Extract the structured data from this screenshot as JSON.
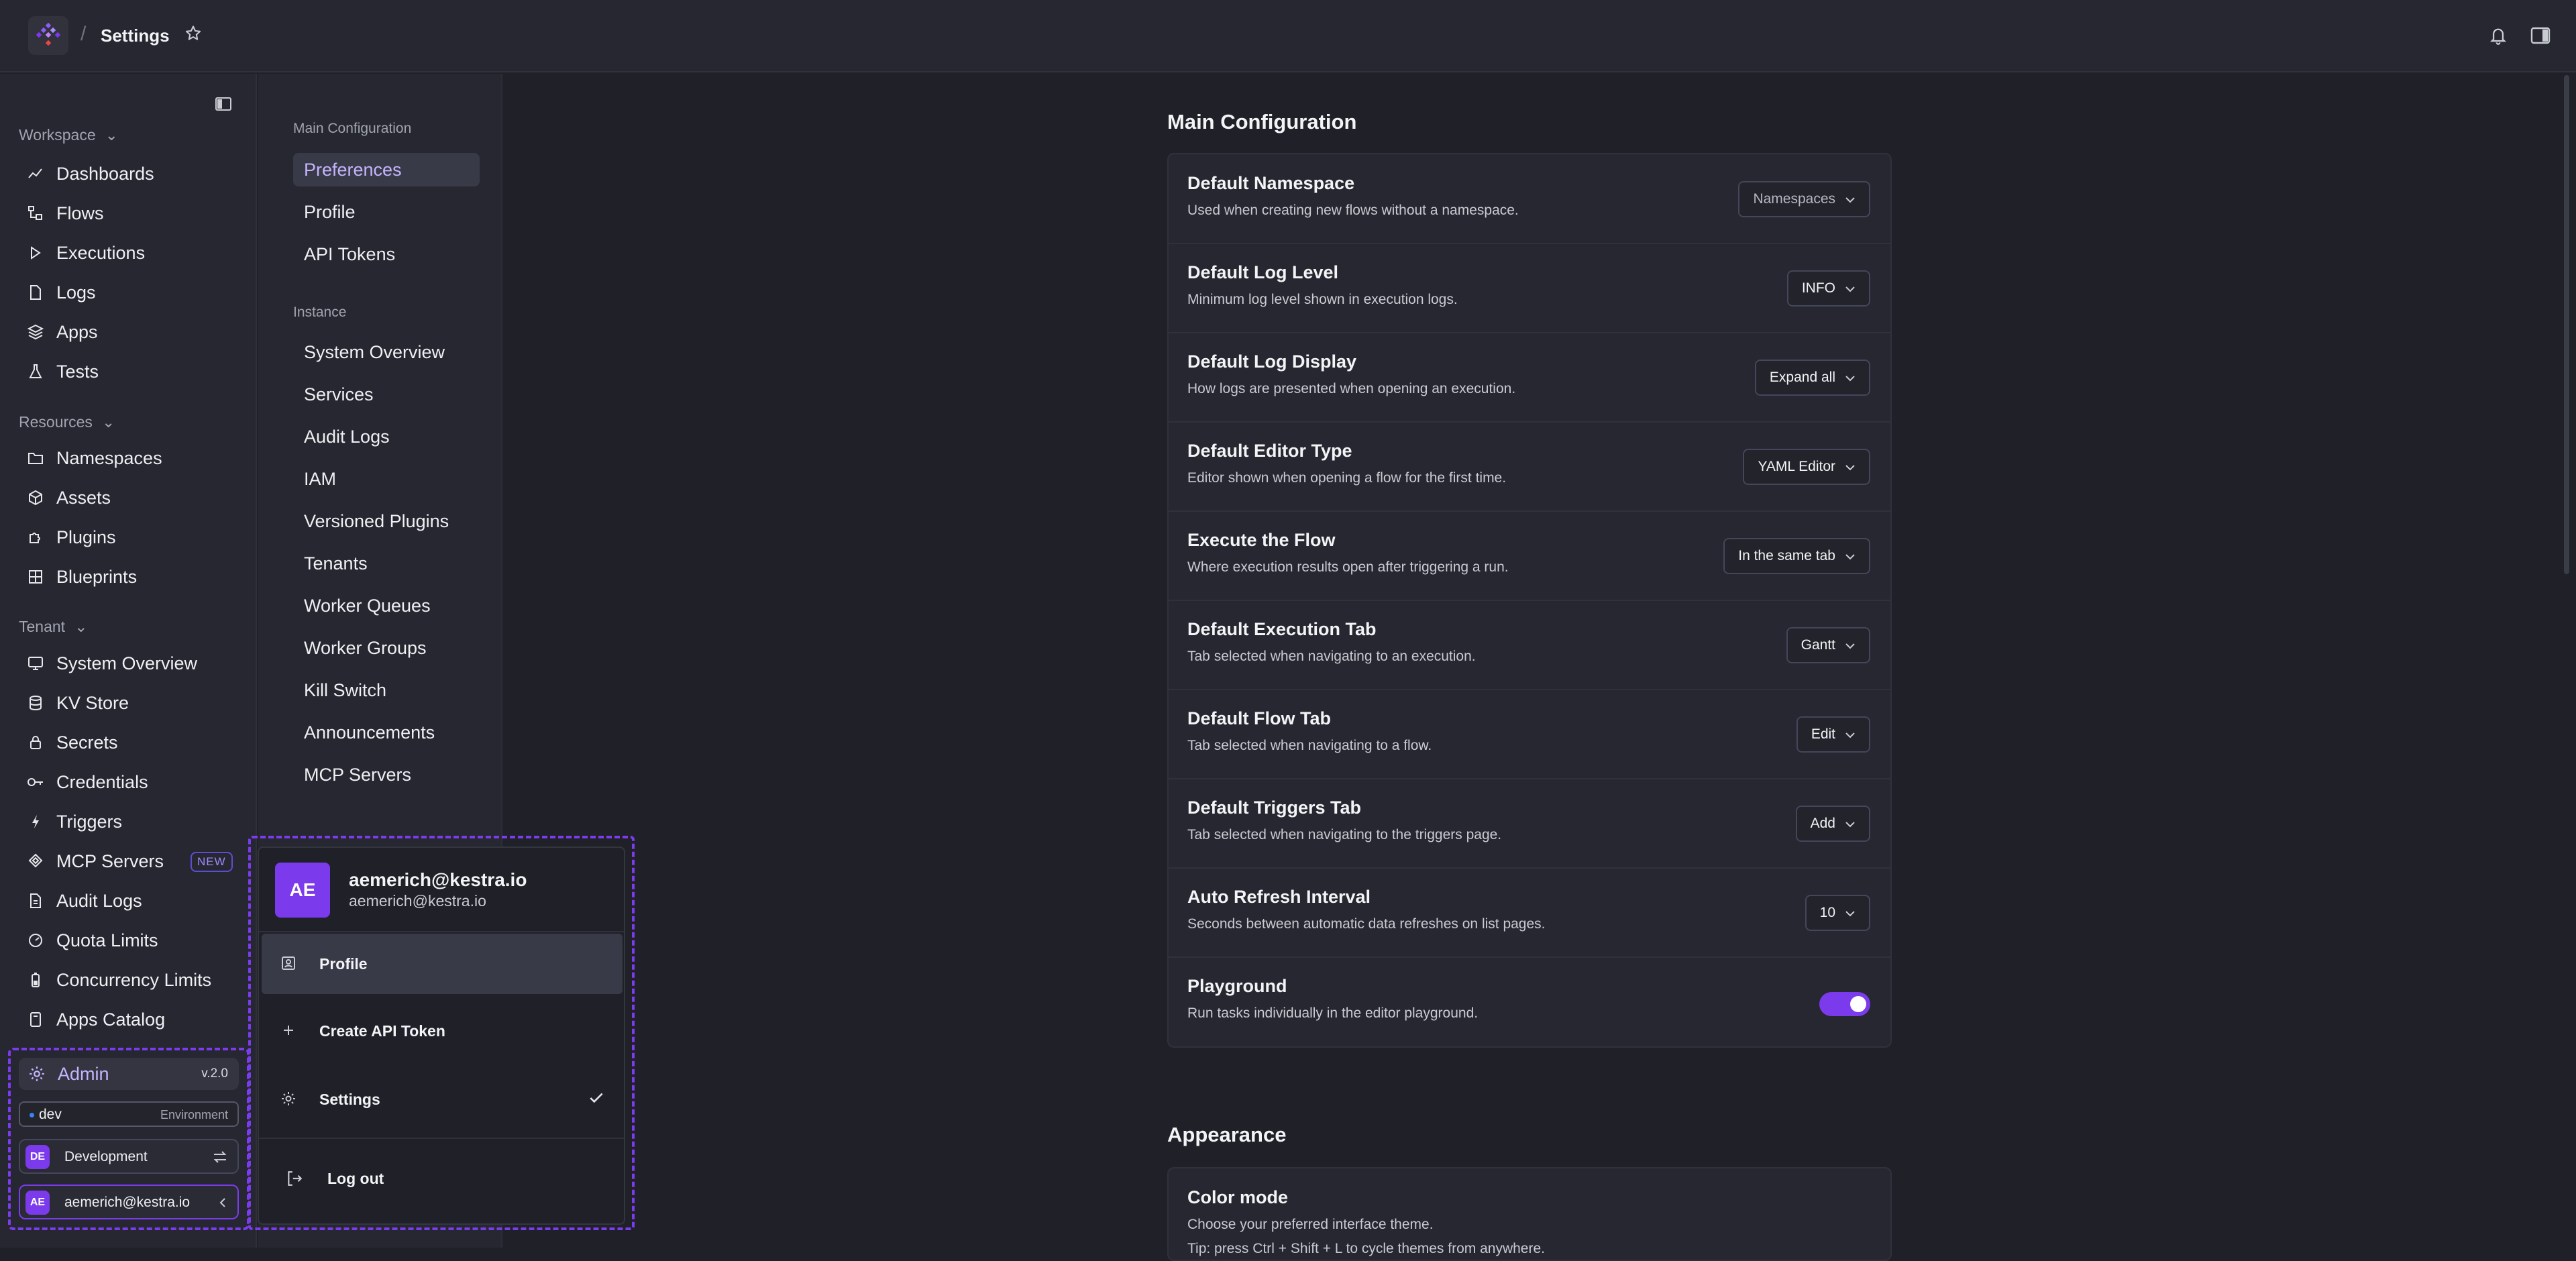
{
  "header": {
    "title": "Settings",
    "separator": "/"
  },
  "sidebar": {
    "workspace_label": "Workspace",
    "resources_label": "Resources",
    "tenant_label": "Tenant",
    "workspace_items": [
      {
        "label": "Dashboards",
        "icon": "chart-line-icon"
      },
      {
        "label": "Flows",
        "icon": "flow-icon"
      },
      {
        "label": "Executions",
        "icon": "play-icon"
      },
      {
        "label": "Logs",
        "icon": "file-icon"
      },
      {
        "label": "Apps",
        "icon": "layers-icon"
      },
      {
        "label": "Tests",
        "icon": "flask-icon"
      }
    ],
    "resource_items": [
      {
        "label": "Namespaces",
        "icon": "folder-icon"
      },
      {
        "label": "Assets",
        "icon": "cube-icon"
      },
      {
        "label": "Plugins",
        "icon": "puzzle-icon"
      },
      {
        "label": "Blueprints",
        "icon": "blueprint-icon"
      }
    ],
    "tenant_items": [
      {
        "label": "System Overview",
        "icon": "monitor-icon"
      },
      {
        "label": "KV Store",
        "icon": "database-icon"
      },
      {
        "label": "Secrets",
        "icon": "lock-icon"
      },
      {
        "label": "Credentials",
        "icon": "key-icon"
      },
      {
        "label": "Triggers",
        "icon": "bolt-icon"
      },
      {
        "label": "MCP Servers",
        "icon": "mcp-icon",
        "badge": "NEW"
      },
      {
        "label": "Audit Logs",
        "icon": "file-icon"
      },
      {
        "label": "Quota Limits",
        "icon": "gauge-icon"
      },
      {
        "label": "Concurrency Limits",
        "icon": "battery-icon"
      },
      {
        "label": "Apps Catalog",
        "icon": "catalog-icon"
      }
    ],
    "admin": {
      "label": "Admin",
      "version": "v.2.0"
    },
    "environment": {
      "name": "dev",
      "label": "Environment"
    },
    "tenant_switch": {
      "initials": "DE",
      "name": "Development"
    },
    "user": {
      "initials": "AE",
      "email": "aemerich@kestra.io"
    }
  },
  "subnav": {
    "main_label": "Main Configuration",
    "main_items": [
      "Preferences",
      "Profile",
      "API Tokens"
    ],
    "instance_label": "Instance",
    "instance_items": [
      "System Overview",
      "Services",
      "Audit Logs",
      "IAM",
      "Versioned Plugins",
      "Tenants",
      "Worker Queues",
      "Worker Groups",
      "Kill Switch",
      "Announcements",
      "MCP Servers"
    ]
  },
  "popup": {
    "initials": "AE",
    "name": "aemerich@kestra.io",
    "email": "aemerich@kestra.io",
    "items": [
      "Profile",
      "Create API Token",
      "Settings",
      "Log out"
    ]
  },
  "main": {
    "main_config_title": "Main Configuration",
    "settings": [
      {
        "title": "Default Namespace",
        "desc": "Used when creating new flows without a namespace.",
        "value": "Namespaces"
      },
      {
        "title": "Default Log Level",
        "desc": "Minimum log level shown in execution logs.",
        "value": "INFO"
      },
      {
        "title": "Default Log Display",
        "desc": "How logs are presented when opening an execution.",
        "value": "Expand all"
      },
      {
        "title": "Default Editor Type",
        "desc": "Editor shown when opening a flow for the first time.",
        "value": "YAML Editor"
      },
      {
        "title": "Execute the Flow",
        "desc": "Where execution results open after triggering a run.",
        "value": "In the same tab"
      },
      {
        "title": "Default Execution Tab",
        "desc": "Tab selected when navigating to an execution.",
        "value": "Gantt"
      },
      {
        "title": "Default Flow Tab",
        "desc": "Tab selected when navigating to a flow.",
        "value": "Edit"
      },
      {
        "title": "Default Triggers Tab",
        "desc": "Tab selected when navigating to the triggers page.",
        "value": "Add"
      },
      {
        "title": "Auto Refresh Interval",
        "desc": "Seconds between automatic data refreshes on list pages.",
        "value": "10"
      },
      {
        "title": "Playground",
        "desc": "Run tasks individually in the editor playground.",
        "value": "on"
      }
    ],
    "appearance_title": "Appearance",
    "color_mode": {
      "title": "Color mode",
      "desc": "Choose your preferred interface theme.",
      "tip": "Tip: press Ctrl + Shift + L to cycle themes from anywhere."
    }
  },
  "colors": {
    "accent": "#7c3aed",
    "accent_text": "#c4b5fd",
    "background": "#1f2028",
    "panel": "#262730"
  }
}
